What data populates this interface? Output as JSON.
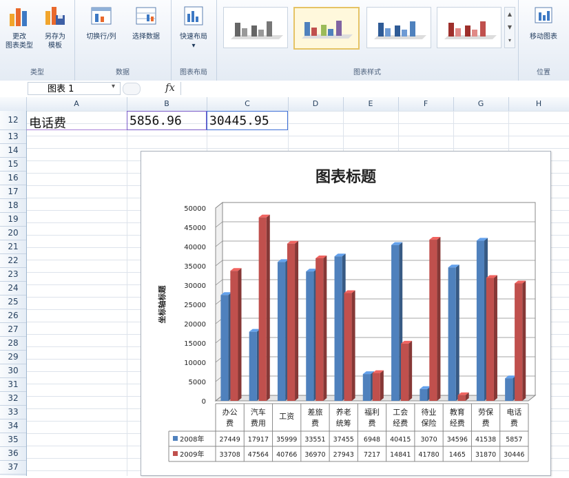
{
  "ribbon": {
    "groups": [
      {
        "label": "类型",
        "buttons": [
          "更改\n图表类型",
          "另存为\n模板"
        ]
      },
      {
        "label": "数据",
        "buttons": [
          "切换行/列",
          "选择数据"
        ]
      },
      {
        "label": "图表布局",
        "buttons": [
          "快速布局"
        ]
      },
      {
        "label": "图表样式",
        "buttons": []
      },
      {
        "label": "位置",
        "buttons": [
          "移动图表"
        ]
      }
    ],
    "change_type_l1": "更改",
    "change_type_l2": "图表类型",
    "save_tpl_l1": "另存为",
    "save_tpl_l2": "模板",
    "switch_rowcol": "切换行/列",
    "select_data": "选择数据",
    "quick_layout": "快速布局",
    "move_chart": "移动图表",
    "group_type": "类型",
    "group_data": "数据",
    "group_layout": "图表布局",
    "group_styles": "图表样式",
    "group_location": "位置"
  },
  "formula_bar": {
    "name_box": "图表 1",
    "fx": "fx"
  },
  "columns": [
    "A",
    "B",
    "C",
    "D",
    "E",
    "F",
    "G",
    "H"
  ],
  "rows": [
    "12",
    "13",
    "14",
    "15",
    "16",
    "17",
    "18",
    "19",
    "20",
    "21",
    "22",
    "23",
    "24",
    "25",
    "26",
    "27",
    "28",
    "29",
    "30",
    "31",
    "32",
    "33",
    "34",
    "35",
    "36",
    "37"
  ],
  "row12": {
    "a": "电话费",
    "b": "5856.96",
    "c": "30445.95"
  },
  "chart_data": {
    "type": "bar",
    "title": "图表标题",
    "ylabel": "坐标轴标题",
    "ylim": [
      0,
      50000
    ],
    "yticks": [
      "0",
      "5000",
      "10000",
      "15000",
      "20000",
      "25000",
      "30000",
      "35000",
      "40000",
      "45000",
      "50000"
    ],
    "categories": [
      "办公费",
      "汽车费用",
      "工资",
      "差旅费",
      "养老统筹",
      "福利费",
      "工会经费",
      "待业保险",
      "教育经费",
      "劳保费",
      "电话费"
    ],
    "category_lines": [
      [
        "办公",
        "费"
      ],
      [
        "汽车",
        "费用"
      ],
      [
        "工资"
      ],
      [
        "差旅",
        "费"
      ],
      [
        "养老",
        "统筹"
      ],
      [
        "福利",
        "费"
      ],
      [
        "工会",
        "经费"
      ],
      [
        "待业",
        "保险"
      ],
      [
        "教育",
        "经费"
      ],
      [
        "劳保",
        "费"
      ],
      [
        "电话",
        "费"
      ]
    ],
    "series": [
      {
        "name": "2008年",
        "color": "#4f81bd",
        "values": [
          27449,
          17917,
          35999,
          33551,
          37455,
          6948,
          40415,
          3070,
          34596,
          41538,
          5857
        ]
      },
      {
        "name": "2009年",
        "color": "#c0504d",
        "values": [
          33708,
          47564,
          40766,
          36970,
          27943,
          7217,
          14841,
          41780,
          1465,
          31870,
          30446
        ]
      }
    ],
    "data_table": true,
    "grid": true
  }
}
